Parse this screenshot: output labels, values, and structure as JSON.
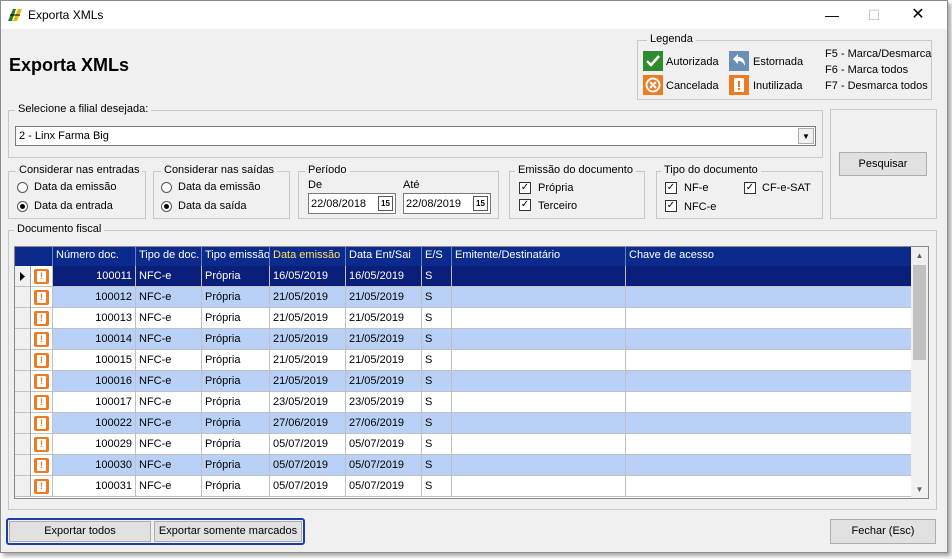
{
  "window": {
    "title": "Exporta XMLs"
  },
  "page": {
    "title": "Exporta XMLs"
  },
  "legend": {
    "caption": "Legenda",
    "items": [
      {
        "icon": "check-icon",
        "label": "Autorizada",
        "color": "#2e8b2e"
      },
      {
        "icon": "return-arrow-icon",
        "label": "Estornada",
        "color": "#6a8fb5"
      },
      {
        "icon": "cancel-icon",
        "label": "Cancelada",
        "color": "#ee7a22"
      },
      {
        "icon": "warning-icon",
        "label": "Inutilizada",
        "color": "#ee7a22"
      }
    ],
    "shortcuts": [
      "F5 - Marca/Desmarca",
      "F6 - Marca todos",
      "F7 - Desmarca todos"
    ]
  },
  "filial": {
    "caption": "Selecione a filial desejada:",
    "value": "2 - Linx Farma Big"
  },
  "search_button": "Pesquisar",
  "entradas": {
    "caption": "Considerar nas entradas",
    "options": [
      "Data da emissão",
      "Data da entrada"
    ],
    "selected": 1
  },
  "saidas": {
    "caption": "Considerar nas saídas",
    "options": [
      "Data da emissão",
      "Data da saída"
    ],
    "selected": 1
  },
  "periodo": {
    "caption": "Período",
    "from_label": "De",
    "to_label": "Até",
    "from": "22/08/2018",
    "to": "22/08/2019",
    "calendar_glyph": "15"
  },
  "emissao": {
    "caption": "Emissão do documento",
    "options": [
      {
        "label": "Própria",
        "checked": true
      },
      {
        "label": "Terceiro",
        "checked": true
      }
    ]
  },
  "tipo": {
    "caption": "Tipo do documento",
    "options": [
      {
        "label": "NF-e",
        "checked": true
      },
      {
        "label": "CF-e-SAT",
        "checked": true
      },
      {
        "label": "NFC-e",
        "checked": true
      }
    ]
  },
  "grid": {
    "caption": "Documento fiscal",
    "columns": [
      "Número doc.",
      "Tipo de doc.",
      "Tipo emissão",
      "Data emissão",
      "Data Ent/Sai",
      "E/S",
      "Emitente/Destinatário",
      "Chave de acesso"
    ],
    "sorted_column": 3,
    "rows": [
      [
        "100011",
        "NFC-e",
        "Própria",
        "16/05/2019",
        "16/05/2019",
        "S",
        "",
        ""
      ],
      [
        "100012",
        "NFC-e",
        "Própria",
        "21/05/2019",
        "21/05/2019",
        "S",
        "",
        ""
      ],
      [
        "100013",
        "NFC-e",
        "Própria",
        "21/05/2019",
        "21/05/2019",
        "S",
        "",
        ""
      ],
      [
        "100014",
        "NFC-e",
        "Própria",
        "21/05/2019",
        "21/05/2019",
        "S",
        "",
        ""
      ],
      [
        "100015",
        "NFC-e",
        "Própria",
        "21/05/2019",
        "21/05/2019",
        "S",
        "",
        ""
      ],
      [
        "100016",
        "NFC-e",
        "Própria",
        "21/05/2019",
        "21/05/2019",
        "S",
        "",
        ""
      ],
      [
        "100017",
        "NFC-e",
        "Própria",
        "23/05/2019",
        "23/05/2019",
        "S",
        "",
        ""
      ],
      [
        "100022",
        "NFC-e",
        "Própria",
        "27/06/2019",
        "27/06/2019",
        "S",
        "",
        ""
      ],
      [
        "100029",
        "NFC-e",
        "Própria",
        "05/07/2019",
        "05/07/2019",
        "S",
        "",
        ""
      ],
      [
        "100030",
        "NFC-e",
        "Própria",
        "05/07/2019",
        "05/07/2019",
        "S",
        "",
        ""
      ],
      [
        "100031",
        "NFC-e",
        "Própria",
        "05/07/2019",
        "05/07/2019",
        "S",
        "",
        ""
      ]
    ],
    "selected_row": 0,
    "row_icon": "warning-icon"
  },
  "footer": {
    "export_all": "Exportar todos",
    "export_marked": "Exportar somente marcados",
    "close": "Fechar (Esc)"
  }
}
